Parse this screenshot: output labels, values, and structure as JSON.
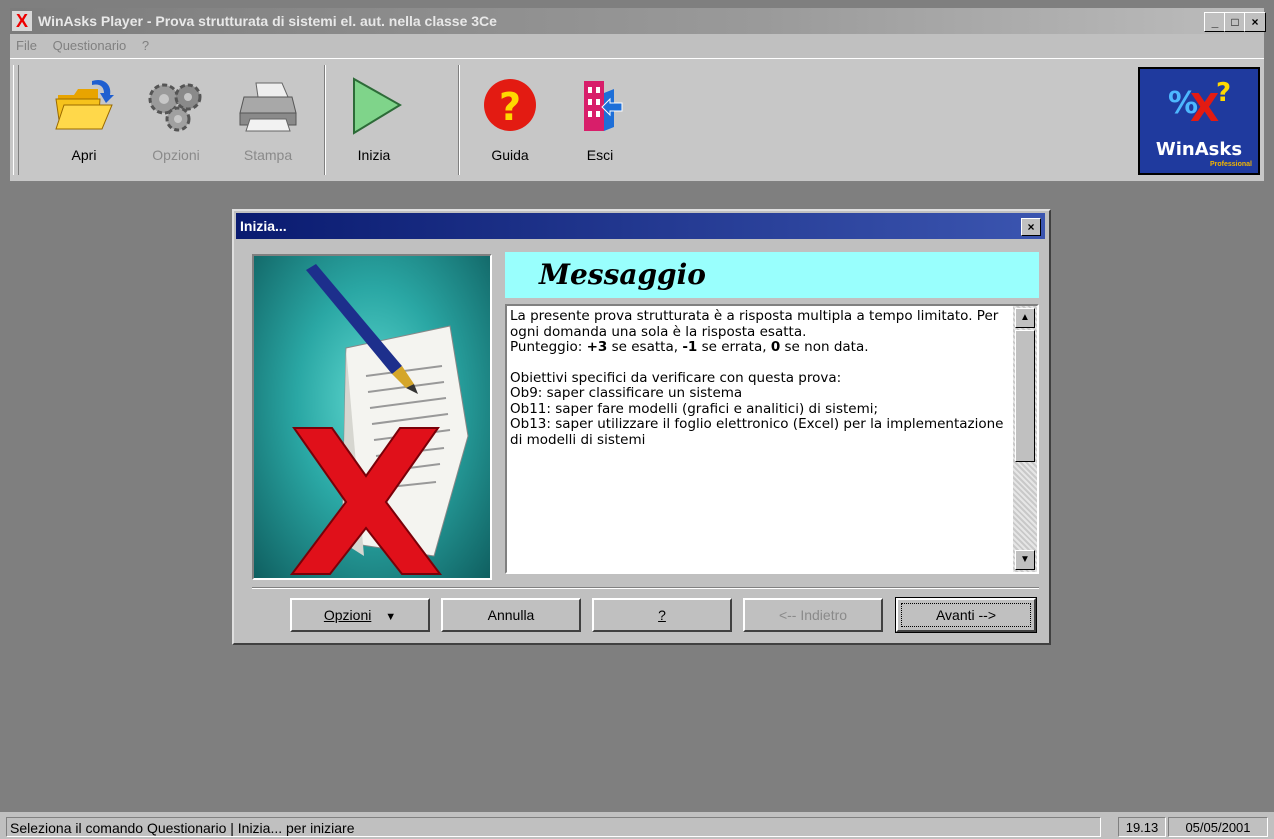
{
  "window": {
    "title": "WinAsks Player - Prova strutturata di sistemi el. aut. nella classe 3Ce",
    "controls": {
      "minimize": "_",
      "maximize": "□",
      "close": "×"
    }
  },
  "menu": [
    "File",
    "Questionario",
    "?"
  ],
  "toolbar": {
    "buttons": [
      {
        "label": "Apri",
        "icon": "folder-open-icon",
        "enabled": true
      },
      {
        "label": "Opzioni",
        "icon": "gears-icon",
        "enabled": false
      },
      {
        "label": "Stampa",
        "icon": "printer-icon",
        "enabled": false
      },
      {
        "label": "Inizia",
        "icon": "play-icon",
        "enabled": true
      },
      {
        "label": "Guida",
        "icon": "help-icon",
        "enabled": true
      },
      {
        "label": "Esci",
        "icon": "exit-door-icon",
        "enabled": true
      }
    ],
    "logo": {
      "text": "WinAsks",
      "sub": "Professional",
      "mark": "%x?"
    }
  },
  "dialog": {
    "title": "Inizia...",
    "close": "×",
    "heading": "Messaggio",
    "message": {
      "p1": "La presente prova strutturata è a risposta multipla a tempo limitato. Per ogni domanda una sola è la risposta esatta.",
      "p2_prefix": "Punteggio: ",
      "p2_plus": "+3",
      "p2_mid1": " se esatta, ",
      "p2_minus": "-1",
      "p2_mid2": " se errata, ",
      "p2_zero": "0",
      "p2_suffix": " se non data.",
      "l1": "Obiettivi specifici da verificare con questa prova:",
      "l2": "Ob9: saper classificare un sistema",
      "l3": "Ob11: saper fare modelli (grafici e analitici) di sistemi;",
      "l4": "Ob13: saper utilizzare il foglio elettronico (Excel) per la implementazione di modelli di sistemi"
    },
    "buttons": {
      "options": "Opzioni",
      "cancel": "Annulla",
      "help": "?",
      "back": "<-- Indietro",
      "next": "Avanti -->"
    }
  },
  "status": {
    "message": "Seleziona il comando Questionario | Inizia... per iniziare",
    "time": "19.13",
    "date": "05/05/2001"
  },
  "colors": {
    "title_active": "#0a1b70",
    "heading_bg": "#99fffd",
    "workspace": "#7f7f7f",
    "face": "#c0c0c0"
  }
}
